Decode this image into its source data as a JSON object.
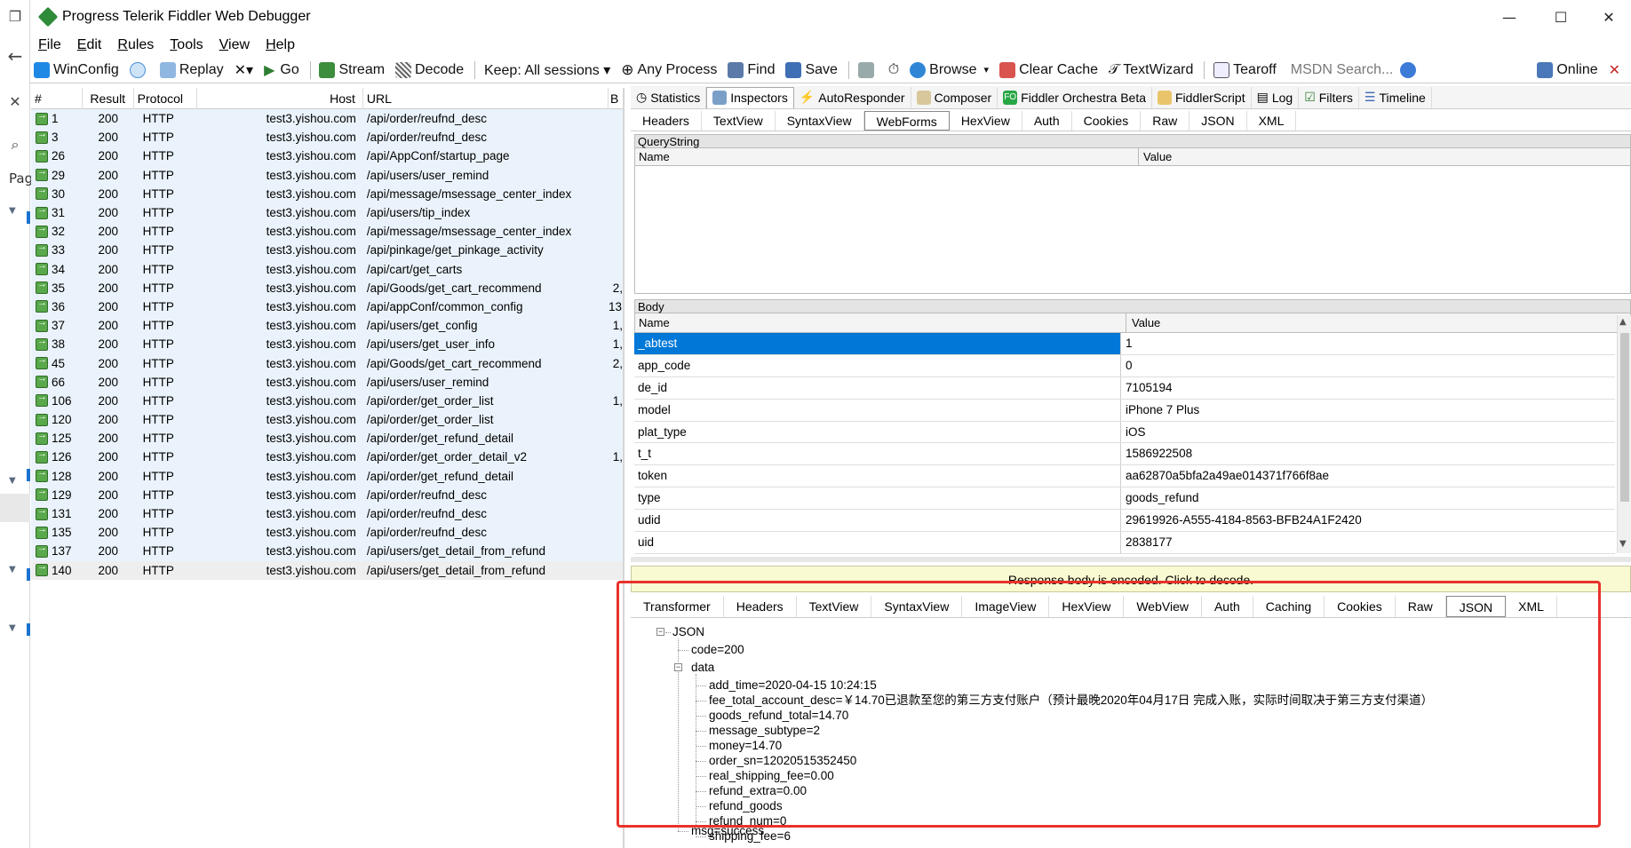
{
  "window": {
    "title": "Progress Telerik Fiddler Web Debugger",
    "minimize": "—",
    "maximize": "☐",
    "close": "✕"
  },
  "left_strip": {
    "label": "Pag"
  },
  "menu": [
    "File",
    "Edit",
    "Rules",
    "Tools",
    "View",
    "Help"
  ],
  "toolbar": {
    "winconfig": "WinConfig",
    "replay": "Replay",
    "remove": "✕▾",
    "go": "Go",
    "stream": "Stream",
    "decode": "Decode",
    "keep": "Keep: All sessions ▾",
    "process": "Any Process",
    "find": "Find",
    "save": "Save",
    "browse": "Browse",
    "browse_caret": "▾",
    "clear_cache": "Clear Cache",
    "textwizard": "TextWizard",
    "tearoff": "Tearoff",
    "search_placeholder": "MSDN Search...",
    "online": "Online",
    "online_close": "✕"
  },
  "sessions": {
    "columns": [
      "#",
      "Result",
      "Protocol",
      "Host",
      "URL",
      "B"
    ],
    "rows": [
      {
        "num": "1",
        "result": "200",
        "protocol": "HTTP",
        "host": "test3.yishou.com",
        "url": "/api/order/reufnd_desc",
        "body": ""
      },
      {
        "num": "3",
        "result": "200",
        "protocol": "HTTP",
        "host": "test3.yishou.com",
        "url": "/api/order/reufnd_desc",
        "body": ""
      },
      {
        "num": "26",
        "result": "200",
        "protocol": "HTTP",
        "host": "test3.yishou.com",
        "url": "/api/AppConf/startup_page",
        "body": ""
      },
      {
        "num": "29",
        "result": "200",
        "protocol": "HTTP",
        "host": "test3.yishou.com",
        "url": "/api/users/user_remind",
        "body": ""
      },
      {
        "num": "30",
        "result": "200",
        "protocol": "HTTP",
        "host": "test3.yishou.com",
        "url": "/api/message/msessage_center_index",
        "body": ""
      },
      {
        "num": "31",
        "result": "200",
        "protocol": "HTTP",
        "host": "test3.yishou.com",
        "url": "/api/users/tip_index",
        "body": ""
      },
      {
        "num": "32",
        "result": "200",
        "protocol": "HTTP",
        "host": "test3.yishou.com",
        "url": "/api/message/msessage_center_index",
        "body": ""
      },
      {
        "num": "33",
        "result": "200",
        "protocol": "HTTP",
        "host": "test3.yishou.com",
        "url": "/api/pinkage/get_pinkage_activity",
        "body": ""
      },
      {
        "num": "34",
        "result": "200",
        "protocol": "HTTP",
        "host": "test3.yishou.com",
        "url": "/api/cart/get_carts",
        "body": ""
      },
      {
        "num": "35",
        "result": "200",
        "protocol": "HTTP",
        "host": "test3.yishou.com",
        "url": "/api/Goods/get_cart_recommend",
        "body": "2,"
      },
      {
        "num": "36",
        "result": "200",
        "protocol": "HTTP",
        "host": "test3.yishou.com",
        "url": "/api/appConf/common_config",
        "body": "13,"
      },
      {
        "num": "37",
        "result": "200",
        "protocol": "HTTP",
        "host": "test3.yishou.com",
        "url": "/api/users/get_config",
        "body": "1,"
      },
      {
        "num": "38",
        "result": "200",
        "protocol": "HTTP",
        "host": "test3.yishou.com",
        "url": "/api/users/get_user_info",
        "body": "1,"
      },
      {
        "num": "45",
        "result": "200",
        "protocol": "HTTP",
        "host": "test3.yishou.com",
        "url": "/api/Goods/get_cart_recommend",
        "body": "2,"
      },
      {
        "num": "66",
        "result": "200",
        "protocol": "HTTP",
        "host": "test3.yishou.com",
        "url": "/api/users/user_remind",
        "body": ""
      },
      {
        "num": "106",
        "result": "200",
        "protocol": "HTTP",
        "host": "test3.yishou.com",
        "url": "/api/order/get_order_list",
        "body": "1,"
      },
      {
        "num": "120",
        "result": "200",
        "protocol": "HTTP",
        "host": "test3.yishou.com",
        "url": "/api/order/get_order_list",
        "body": ""
      },
      {
        "num": "125",
        "result": "200",
        "protocol": "HTTP",
        "host": "test3.yishou.com",
        "url": "/api/order/get_refund_detail",
        "body": ""
      },
      {
        "num": "126",
        "result": "200",
        "protocol": "HTTP",
        "host": "test3.yishou.com",
        "url": "/api/order/get_order_detail_v2",
        "body": "1,"
      },
      {
        "num": "128",
        "result": "200",
        "protocol": "HTTP",
        "host": "test3.yishou.com",
        "url": "/api/order/get_refund_detail",
        "body": ""
      },
      {
        "num": "129",
        "result": "200",
        "protocol": "HTTP",
        "host": "test3.yishou.com",
        "url": "/api/order/reufnd_desc",
        "body": ""
      },
      {
        "num": "131",
        "result": "200",
        "protocol": "HTTP",
        "host": "test3.yishou.com",
        "url": "/api/order/reufnd_desc",
        "body": ""
      },
      {
        "num": "135",
        "result": "200",
        "protocol": "HTTP",
        "host": "test3.yishou.com",
        "url": "/api/order/reufnd_desc",
        "body": ""
      },
      {
        "num": "137",
        "result": "200",
        "protocol": "HTTP",
        "host": "test3.yishou.com",
        "url": "/api/users/get_detail_from_refund",
        "body": ""
      },
      {
        "num": "140",
        "result": "200",
        "protocol": "HTTP",
        "host": "test3.yishou.com",
        "url": "/api/users/get_detail_from_refund",
        "body": ""
      }
    ]
  },
  "main_tabs": [
    "Statistics",
    "Inspectors",
    "AutoResponder",
    "Composer",
    "Fiddler Orchestra Beta",
    "FiddlerScript",
    "Log",
    "Filters",
    "Timeline"
  ],
  "request_tabs": [
    "Headers",
    "TextView",
    "SyntaxView",
    "WebForms",
    "HexView",
    "Auth",
    "Cookies",
    "Raw",
    "JSON",
    "XML"
  ],
  "querystring": {
    "title": "QueryString",
    "col_name": "Name",
    "col_value": "Value"
  },
  "body": {
    "title": "Body",
    "col_name": "Name",
    "col_value": "Value",
    "rows": [
      {
        "name": "_abtest",
        "value": "1"
      },
      {
        "name": "app_code",
        "value": "0"
      },
      {
        "name": "de_id",
        "value": "7105194"
      },
      {
        "name": "model",
        "value": "iPhone 7 Plus"
      },
      {
        "name": "plat_type",
        "value": "iOS"
      },
      {
        "name": "t_t",
        "value": "1586922508"
      },
      {
        "name": "token",
        "value": "aa62870a5bfa2a49ae014371f766f8ae"
      },
      {
        "name": "type",
        "value": "goods_refund"
      },
      {
        "name": "udid",
        "value": "29619926-A555-4184-8563-BFB24A1F2420"
      },
      {
        "name": "uid",
        "value": "2838177"
      }
    ]
  },
  "encoded_notice": "Response body is encoded. Click to decode.",
  "response_tabs": [
    "Transformer",
    "Headers",
    "TextView",
    "SyntaxView",
    "ImageView",
    "HexView",
    "WebView",
    "Auth",
    "Caching",
    "Cookies",
    "Raw",
    "JSON",
    "XML"
  ],
  "json_tree": {
    "root": "JSON",
    "code": "code=200",
    "data": "data",
    "data_items": [
      "add_time=2020-04-15 10:24:15",
      "fee_total_account_desc=￥14.70已退款至您的第三方支付账户（预计最晚2020年04月17日 完成入账，实际时间取决于第三方支付渠道）",
      "goods_refund_total=14.70",
      "message_subtype=2",
      "money=14.70",
      "order_sn=12020515352450",
      "real_shipping_fee=0.00",
      "refund_extra=0.00",
      "refund_goods",
      "refund_num=0",
      "shipping_fee=6"
    ],
    "msg": "msg=success"
  },
  "colors": {
    "selection": "#0078d7",
    "session_bg": "#eaf3fb",
    "highlight_box": "#e8322b"
  }
}
